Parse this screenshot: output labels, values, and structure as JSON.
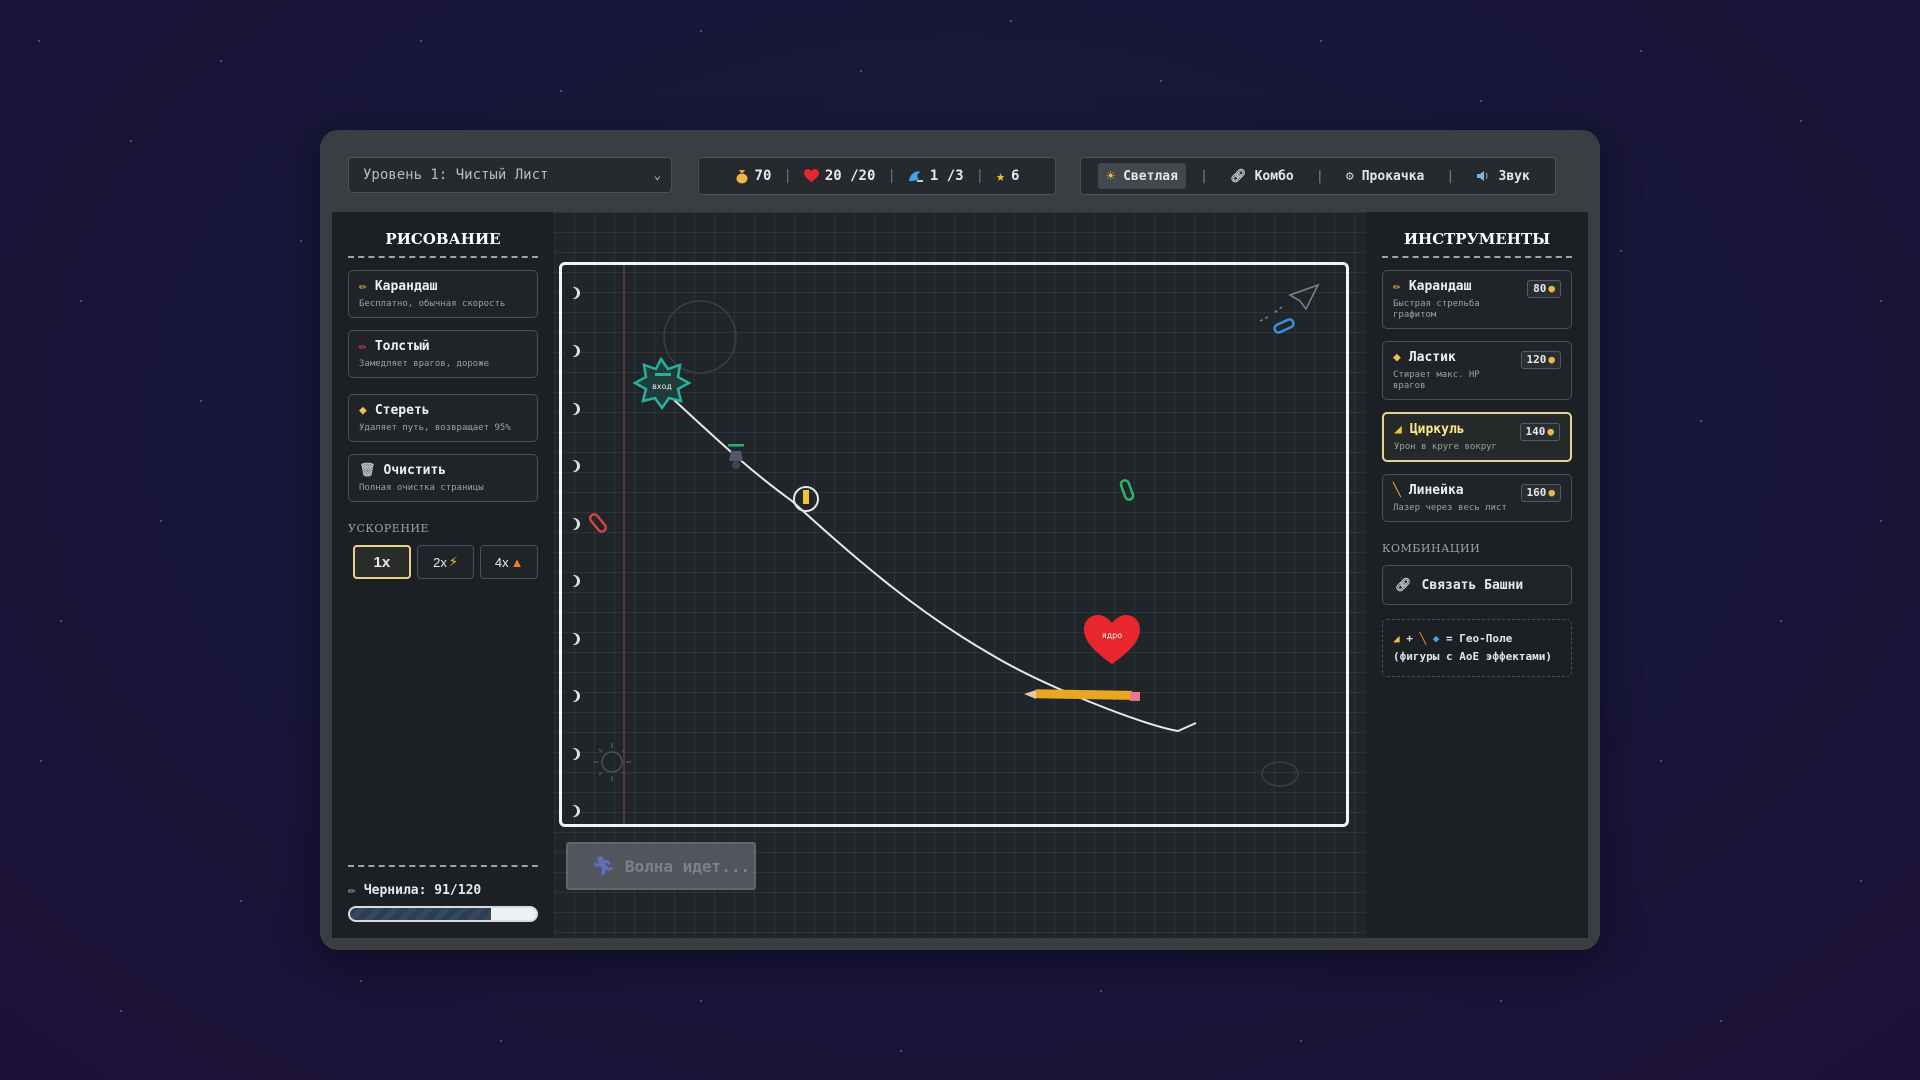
{
  "level": {
    "selected": "Уровень 1: Чистый Лист"
  },
  "stats": {
    "coins": "70",
    "lives": "20 /20",
    "wave": "1 /3",
    "stars": "6"
  },
  "toolbar": {
    "theme": "Светлая",
    "combo": "Комбо",
    "upgrade": "Прокачка",
    "sound": "Звук"
  },
  "left_panel": {
    "title": "РИСОВАНИЕ",
    "items": [
      {
        "title": "Карандаш",
        "desc": "Бесплатно, обычная скорость"
      },
      {
        "title": "Толстый",
        "desc": "Замедляет врагов, дороже"
      },
      {
        "title": "Стереть",
        "desc": "Удаляет путь, возвращает 95%"
      },
      {
        "title": "Очистить",
        "desc": "Полная очистка страницы"
      }
    ],
    "speed_label": "УСКОРЕНИЕ",
    "speeds": [
      "1x",
      "2x",
      "4x"
    ],
    "ink_label": "Чернила: 91/120",
    "ink_value": 91,
    "ink_max": 120
  },
  "right_panel": {
    "title": "ИНСТРУМЕНТЫ",
    "tools": [
      {
        "title": "Карандаш",
        "desc": "Быстрая стрельба графитом",
        "cost": "80"
      },
      {
        "title": "Ластик",
        "desc": "Стирает макс. HP врагов",
        "cost": "120"
      },
      {
        "title": "Циркуль",
        "desc": "Урон в круге вокруг",
        "cost": "140"
      },
      {
        "title": "Линейка",
        "desc": "Лазер через весь лист",
        "cost": "160"
      }
    ],
    "combos_label": "КОМБИНАЦИИ",
    "link_button": "Связать Башни",
    "combo_info": "= Гео-Поле (фигуры с AoE эффектами)"
  },
  "canvas": {
    "start_label": "вход",
    "end_label": "ядро",
    "wave_button": "Волна идет..."
  },
  "colors": {
    "accent_gold": "#e7d38b",
    "heart": "#e8262d",
    "path": "#e8e8e8",
    "start_star": "#23b3a0"
  }
}
